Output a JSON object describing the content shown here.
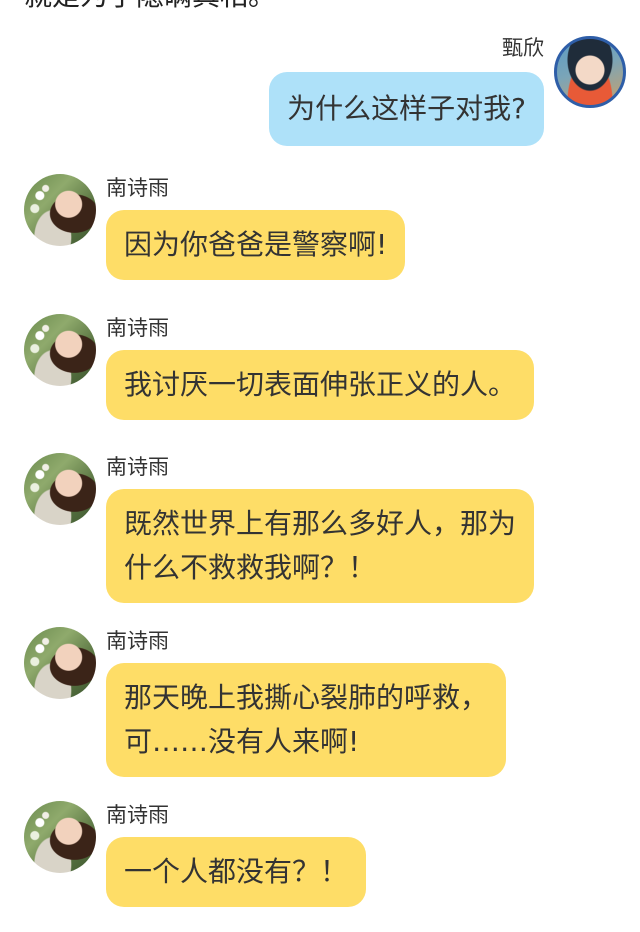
{
  "top_partial_text": "就是为了隐瞒真相。",
  "messages": [
    {
      "side": "right",
      "sender": "甄欣",
      "avatar_icon": "boy-avatar-icon",
      "lines": [
        "为什么这样子对我?"
      ]
    },
    {
      "side": "left",
      "sender": "南诗雨",
      "avatar_icon": "girl-avatar-icon",
      "lines": [
        "因为你爸爸是警察啊!"
      ]
    },
    {
      "side": "left",
      "sender": "南诗雨",
      "avatar_icon": "girl-avatar-icon",
      "lines": [
        "我讨厌一切表面伸张正义的人。"
      ]
    },
    {
      "side": "left",
      "sender": "南诗雨",
      "avatar_icon": "girl-avatar-icon",
      "lines": [
        "既然世界上有那么多好人，那为",
        "什么不救救我啊？！"
      ]
    },
    {
      "side": "left",
      "sender": "南诗雨",
      "avatar_icon": "girl-avatar-icon",
      "lines": [
        "那天晚上我撕心裂肺的呼救，",
        "可……没有人来啊!"
      ]
    },
    {
      "side": "left",
      "sender": "南诗雨",
      "avatar_icon": "girl-avatar-icon",
      "lines": [
        "一个人都没有？！"
      ]
    }
  ],
  "colors": {
    "outgoing_bubble": "#aee1f9",
    "incoming_bubble": "#fedd67",
    "background": "#ffffff"
  }
}
